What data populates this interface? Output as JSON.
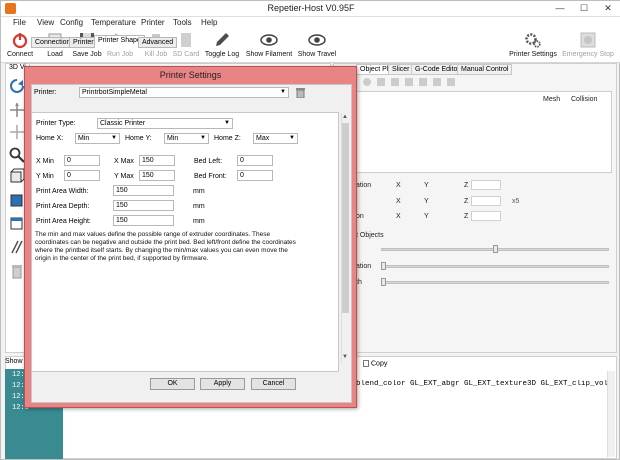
{
  "app": {
    "title": "Repetier-Host V0.95F",
    "window_controls": [
      "—",
      "☐",
      "✕"
    ]
  },
  "menu": [
    "File",
    "View",
    "Config",
    "Temperature",
    "Printer",
    "Tools",
    "Help"
  ],
  "toolbar": {
    "connect": "Connect",
    "load": "Load",
    "save_job": "Save Job",
    "run_job": "Run Job",
    "kill_job": "Kill Job",
    "sd_card": "SD Card",
    "toggle_log": "Toggle Log",
    "show_filament": "Show Filament",
    "show_travel": "Show Travel",
    "printer_settings": "Printer Settings",
    "emergency_stop": "Emergency Stop"
  },
  "left_tab": "3D Vi",
  "right_tabs": [
    "Object Placement",
    "Slicer",
    "G-Code Editor",
    "Manual Control"
  ],
  "right_pane": {
    "columns": [
      "Mesh",
      "Collision"
    ],
    "row_labels": [
      "ation",
      "",
      "on"
    ],
    "axes": [
      "X",
      "Y",
      "Z"
    ],
    "objects_label": "t Objects",
    "slider_labels": [
      "",
      "ation",
      "th"
    ],
    "badge": "x5"
  },
  "log": {
    "header": "Show",
    "copy": "Copy",
    "times": [
      "12:5",
      "12:5",
      "12:5",
      "12:5"
    ],
    "text": "blend_color GL_EXT_abgr GL_EXT_texture3D GL_EXT_clip_volu"
  },
  "dialog": {
    "title": "Printer Settings",
    "printer_label": "Printer:",
    "printer_value": "PrintrbotSimpleMetal",
    "tabs": [
      "Connection",
      "Printer",
      "Printer Shape",
      "Advanced"
    ],
    "printer_type_label": "Printer Type:",
    "printer_type_value": "Classic Printer",
    "home_x_label": "Home X:",
    "home_x_value": "Min",
    "home_y_label": "Home Y:",
    "home_y_value": "Min",
    "home_z_label": "Home Z:",
    "home_z_value": "Max",
    "x_min_label": "X Min",
    "x_min_value": "0",
    "x_max_label": "X Max",
    "x_max_value": "150",
    "bed_left_label": "Bed Left:",
    "bed_left_value": "0",
    "y_min_label": "Y Min",
    "y_min_value": "0",
    "y_max_label": "Y Max",
    "y_max_value": "150",
    "bed_front_label": "Bed Front:",
    "bed_front_value": "0",
    "width_label": "Print Area Width:",
    "width_value": "150",
    "width_unit": "mm",
    "depth_label": "Print Area Depth:",
    "depth_value": "150",
    "depth_unit": "mm",
    "height_label": "Print Area Height:",
    "height_value": "150",
    "height_unit": "mm",
    "description": "The min and max values define the possible range of extruder coordinates. These coordinates can be negative and outside the print bed. Bed left/front define the coordinates where the printbed itself starts. By changing the min/max values you can even move the origin in the center of the print bed, if supported by firmware.",
    "ok": "OK",
    "apply": "Apply",
    "cancel": "Cancel"
  }
}
